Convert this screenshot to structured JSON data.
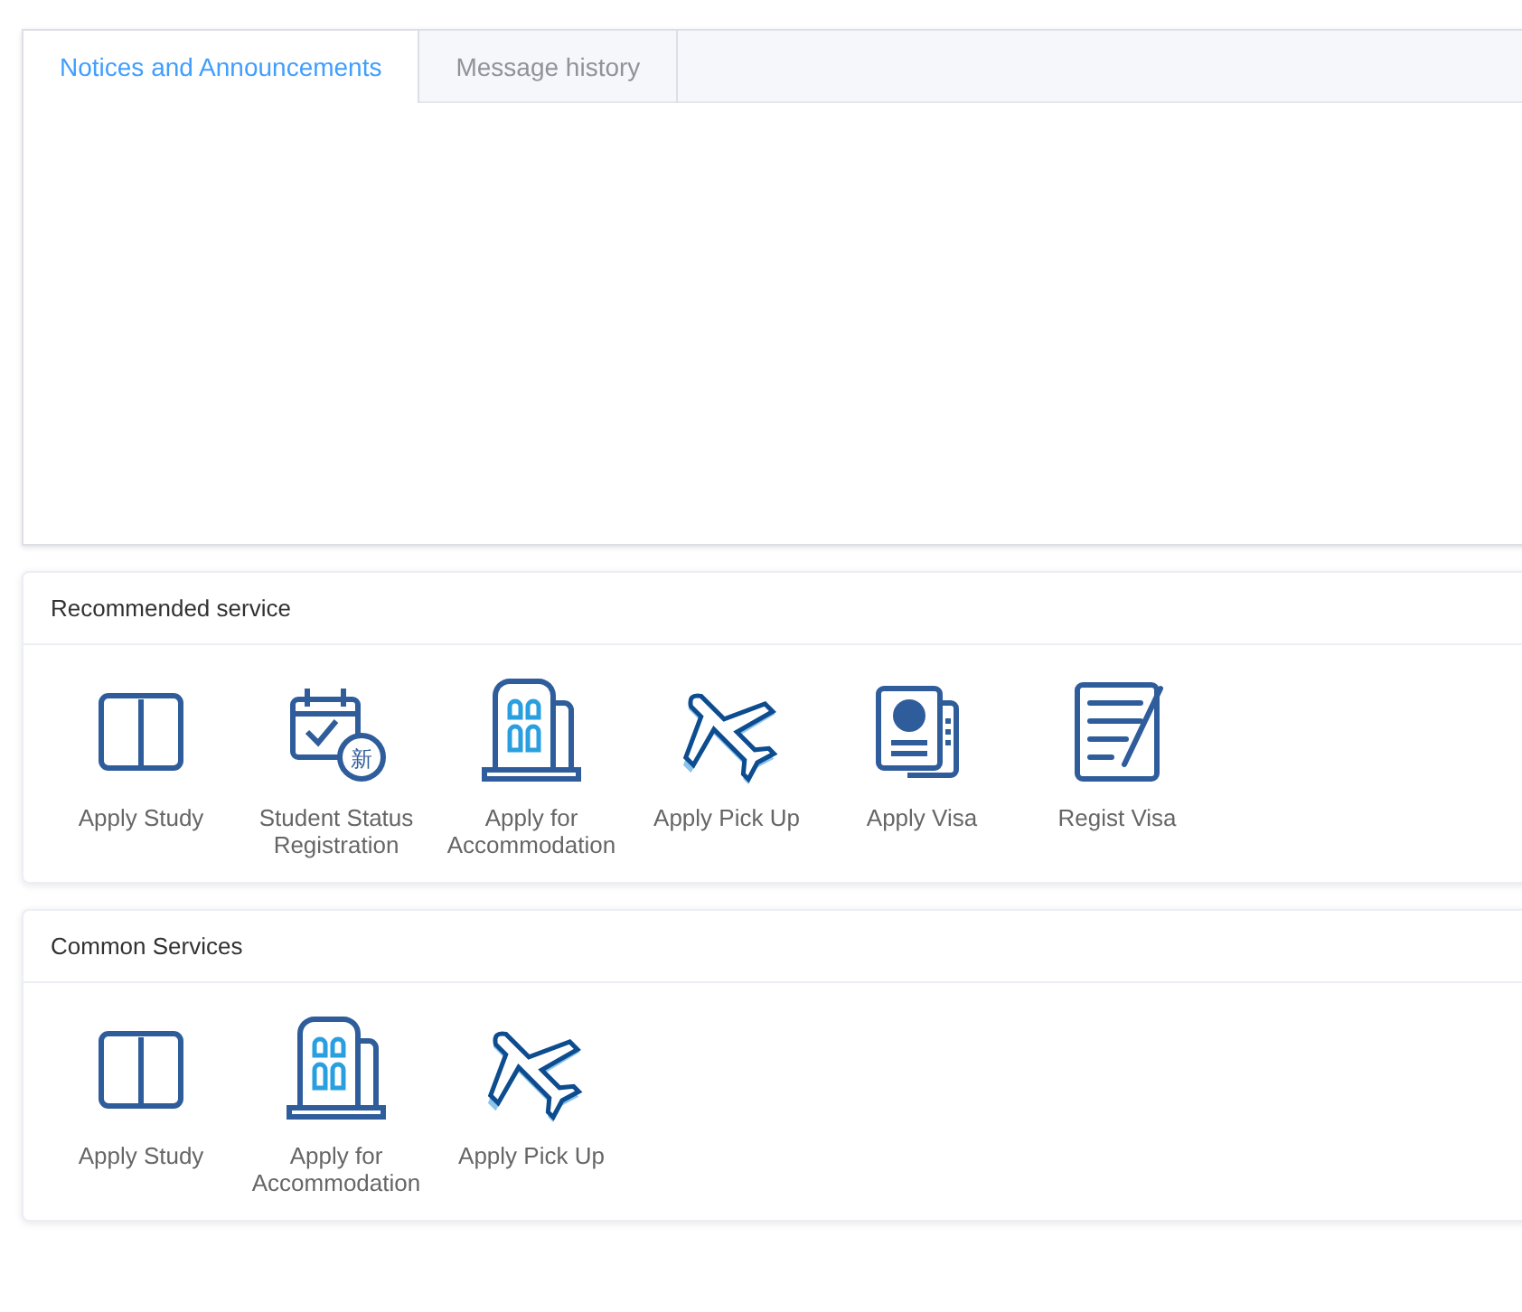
{
  "tabs": [
    {
      "label": "Notices and Announcements",
      "selected": true
    },
    {
      "label": "Message history",
      "selected": false
    }
  ],
  "sections": [
    {
      "title": "Recommended service",
      "services": [
        {
          "label": "Apply Study",
          "kind": "book"
        },
        {
          "label": "Student Status Registration",
          "kind": "calendar",
          "icon_text": "新"
        },
        {
          "label": "Apply for Accommodation",
          "kind": "building"
        },
        {
          "label": "Apply Pick Up",
          "kind": "plane"
        },
        {
          "label": "Apply Visa",
          "kind": "passport"
        },
        {
          "label": "Regist Visa",
          "kind": "form"
        }
      ]
    },
    {
      "title": "Common Services",
      "services": [
        {
          "label": "Apply Study",
          "kind": "book"
        },
        {
          "label": "Apply for Accommodation",
          "kind": "building"
        },
        {
          "label": "Apply Pick Up",
          "kind": "plane"
        }
      ]
    }
  ]
}
